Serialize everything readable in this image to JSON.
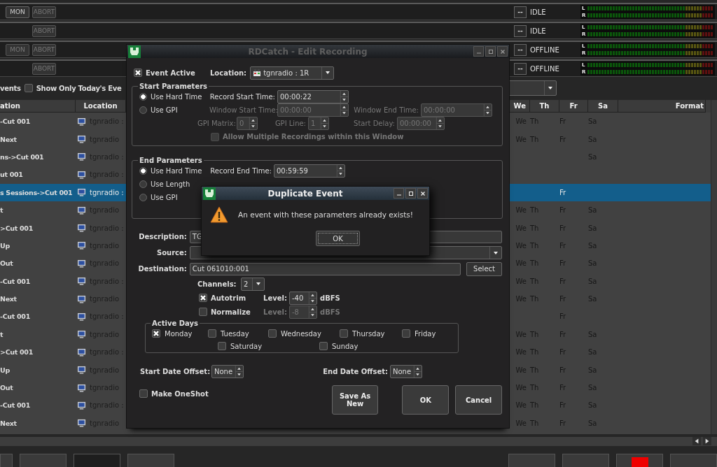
{
  "decks": [
    {
      "monitor": {
        "label": "MON",
        "disabled": false
      },
      "abort": {
        "label": "ABORT",
        "disabled": true
      },
      "mode": "--",
      "status": "IDLE",
      "meter": [
        "L",
        "R"
      ]
    },
    {
      "abort": {
        "label": "ABORT",
        "disabled": true
      },
      "mode": "--",
      "status": "IDLE",
      "meter": [
        "L",
        "R"
      ]
    },
    {
      "monitor": {
        "label": "MON",
        "disabled": true
      },
      "abort": {
        "label": "ABORT",
        "disabled": true
      },
      "mode": "--",
      "status": "OFFLINE",
      "meter": [
        "L",
        "R"
      ]
    },
    {
      "abort": {
        "label": "ABORT",
        "disabled": true
      },
      "mode": "--",
      "status": "OFFLINE",
      "meter": [
        "L",
        "R"
      ]
    }
  ],
  "filter": {
    "label": "vents",
    "today_only": {
      "label": "Show Only Today's Eve",
      "checked": false
    }
  },
  "table": {
    "columns": [
      "ation",
      "Location",
      "We",
      "Th",
      "Fr",
      "Sa",
      "Format"
    ],
    "rows": [
      {
        "description": "-Cut 001",
        "location": "tgnradio :",
        "we": "We",
        "th": "Th",
        "fr": "Fr",
        "sa": "Sa",
        "selected": false
      },
      {
        "description": "Next",
        "location": "tgnradio",
        "we": "We",
        "th": "Th",
        "fr": "Fr",
        "sa": "Sa",
        "selected": false
      },
      {
        "description": "ns->Cut 001",
        "location": "tgnradio :",
        "sa": "Sa",
        "selected": false
      },
      {
        "description": "ut 001",
        "location": "tgnradio :",
        "selected": false
      },
      {
        "description": "s Sessions->Cut 001",
        "location": "tgnradio :",
        "fr": "Fr",
        "selected": true
      },
      {
        "description": "t",
        "location": "tgnradio",
        "we": "We",
        "th": "Th",
        "fr": "Fr",
        "sa": "Sa",
        "selected": false
      },
      {
        "description": ">Cut 001",
        "location": "tgnradio :",
        "we": "We",
        "th": "Th",
        "fr": "Fr",
        "sa": "Sa",
        "selected": false
      },
      {
        "description": "Up",
        "location": "tgnradio",
        "we": "We",
        "th": "Th",
        "fr": "Fr",
        "sa": "Sa",
        "selected": false
      },
      {
        "description": "Out",
        "location": "tgnradio",
        "we": "We",
        "th": "Th",
        "fr": "Fr",
        "sa": "Sa",
        "selected": false
      },
      {
        "description": "-Cut 001",
        "location": "tgnradio :",
        "we": "We",
        "th": "Th",
        "fr": "Fr",
        "sa": "Sa",
        "selected": false
      },
      {
        "description": "Next",
        "location": "tgnradio",
        "we": "We",
        "th": "Th",
        "fr": "Fr",
        "sa": "Sa",
        "selected": false
      },
      {
        "description": "-Cut 001",
        "location": "tgnradio :",
        "fr": "Fr",
        "selected": false
      },
      {
        "description": "t",
        "location": "tgnradio",
        "we": "We",
        "th": "Th",
        "fr": "Fr",
        "sa": "Sa",
        "selected": false
      },
      {
        "description": ">Cut 001",
        "location": "tgnradio :",
        "we": "We",
        "th": "Th",
        "fr": "Fr",
        "sa": "Sa",
        "selected": false
      },
      {
        "description": "Up",
        "location": "tgnradio",
        "we": "We",
        "th": "Th",
        "fr": "Fr",
        "sa": "Sa",
        "selected": false
      },
      {
        "description": "Out",
        "location": "tgnradio",
        "we": "We",
        "th": "Th",
        "fr": "Fr",
        "sa": "Sa",
        "selected": false
      },
      {
        "description": "-Cut 001",
        "location": "tgnradio :",
        "we": "We",
        "th": "Th",
        "fr": "Fr",
        "sa": "Sa",
        "selected": false
      },
      {
        "description": "Next",
        "location": "tgnradio",
        "we": "We",
        "th": "Th",
        "fr": "Fr",
        "sa": "Sa",
        "selected": false
      }
    ]
  },
  "edit_dialog": {
    "title": "RDCatch - Edit Recording",
    "event_active": {
      "label": "Event Active",
      "checked": true
    },
    "location": {
      "label": "Location:",
      "value": "tgnradio : 1R"
    },
    "start_parameters": {
      "title": "Start Parameters",
      "modes": [
        {
          "label": "Use Hard Time",
          "selected": true
        },
        {
          "label": "Use GPI",
          "selected": false
        }
      ],
      "record_start_time": {
        "label": "Record Start Time:",
        "value": "00:00:22",
        "disabled": false
      },
      "window_start_time": {
        "label": "Window Start Time:",
        "value": "00:00:00",
        "disabled": true
      },
      "window_end_time": {
        "label": "Window End Time:",
        "value": "00:00:00",
        "disabled": true
      },
      "gpi_matrix": {
        "label": "GPI Matrix:",
        "value": "0",
        "disabled": true
      },
      "gpi_line": {
        "label": "GPI Line:",
        "value": "1",
        "disabled": true
      },
      "start_delay": {
        "label": "Start Delay:",
        "value": "00:00:00",
        "disabled": true
      },
      "allow_multiple": {
        "label": "Allow Multiple Recordings within this Window",
        "checked": false,
        "disabled": true
      }
    },
    "end_parameters": {
      "title": "End Parameters",
      "modes": [
        {
          "label": "Use Hard Time",
          "selected": true
        },
        {
          "label": "Use Length",
          "selected": false
        },
        {
          "label": "Use GPI",
          "selected": false
        }
      ],
      "record_end_time": {
        "label": "Record End Time:",
        "value": "00:59:59",
        "disabled": false
      }
    },
    "description": {
      "label": "Description:",
      "value": "TG"
    },
    "source": {
      "label": "Source:"
    },
    "destination": {
      "label": "Destination:",
      "value": "Cut 061010:001",
      "button": "Select"
    },
    "channels": {
      "label": "Channels:",
      "value": "2"
    },
    "autotrim": {
      "label": "Autotrim",
      "checked": true,
      "threshold_label": "Level:",
      "threshold": "-40",
      "unit": "dBFS",
      "disabled": false
    },
    "normalize": {
      "label": "Normalize",
      "checked": false,
      "threshold_label": "Level:",
      "threshold": "-8",
      "unit": "dBFS",
      "disabled": true
    },
    "active_days": {
      "title": "Active Days",
      "days": [
        {
          "label": "Monday",
          "checked": true
        },
        {
          "label": "Tuesday",
          "checked": false
        },
        {
          "label": "Wednesday",
          "checked": false
        },
        {
          "label": "Thursday",
          "checked": false
        },
        {
          "label": "Friday",
          "checked": false
        },
        {
          "label": "Saturday",
          "checked": false
        },
        {
          "label": "Sunday",
          "checked": false
        }
      ]
    },
    "start_date_offset": {
      "label": "Start Date Offset:",
      "value": "None"
    },
    "end_date_offset": {
      "label": "End Date Offset:",
      "value": "None"
    },
    "make_oneshot": {
      "label": "Make OneShot",
      "checked": false
    },
    "buttons": [
      "Save As New",
      "OK",
      "Cancel"
    ]
  },
  "duplicate_dialog": {
    "title": "Duplicate Event",
    "message": "An event with these parameters already exists!",
    "button": "OK"
  }
}
